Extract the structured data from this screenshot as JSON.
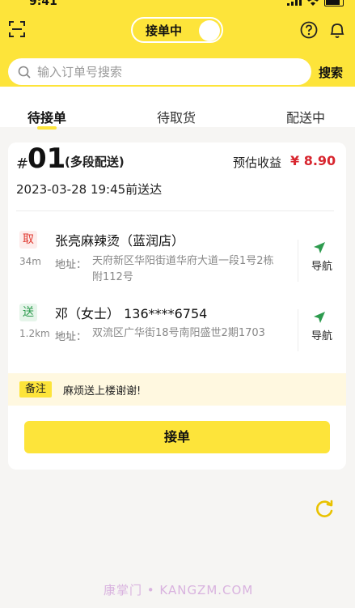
{
  "status_bar": {
    "time": "9:41"
  },
  "header": {
    "toggle_label": "接单中",
    "search_placeholder": "输入订单号搜索",
    "search_button": "搜索"
  },
  "tabs": [
    {
      "label": "待接单",
      "active": true
    },
    {
      "label": "待取货",
      "active": false
    },
    {
      "label": "配送中",
      "active": false
    }
  ],
  "order": {
    "hash": "#",
    "number": "01",
    "type": "(多段配送)",
    "income_label": "预估收益",
    "income_value": "¥ 8.90",
    "deliver_time": "2023-03-28 19:45前送达",
    "pickup": {
      "tag": "取",
      "distance": "34m",
      "name": "张亮麻辣烫（蓝润店）",
      "address_label": "地址：",
      "address": "天府新区华阳街道华府大道一段1号2栋附112号",
      "nav_label": "导航"
    },
    "dropoff": {
      "tag": "送",
      "distance": "1.2km",
      "name": "邓（女士） 136****6754",
      "address_label": "地址：",
      "address": "双流区广华街18号南阳盛世2期1703",
      "nav_label": "导航"
    },
    "note_badge": "备注",
    "note_text": "麻烦送上楼谢谢!",
    "accept_button": "接单"
  },
  "watermark": "康掌门 • KANGZM.COM",
  "colors": {
    "accent": "#fde43a",
    "income": "#d8262f",
    "nav_green": "#2d9b4e",
    "pickup_red": "#e0382f"
  }
}
